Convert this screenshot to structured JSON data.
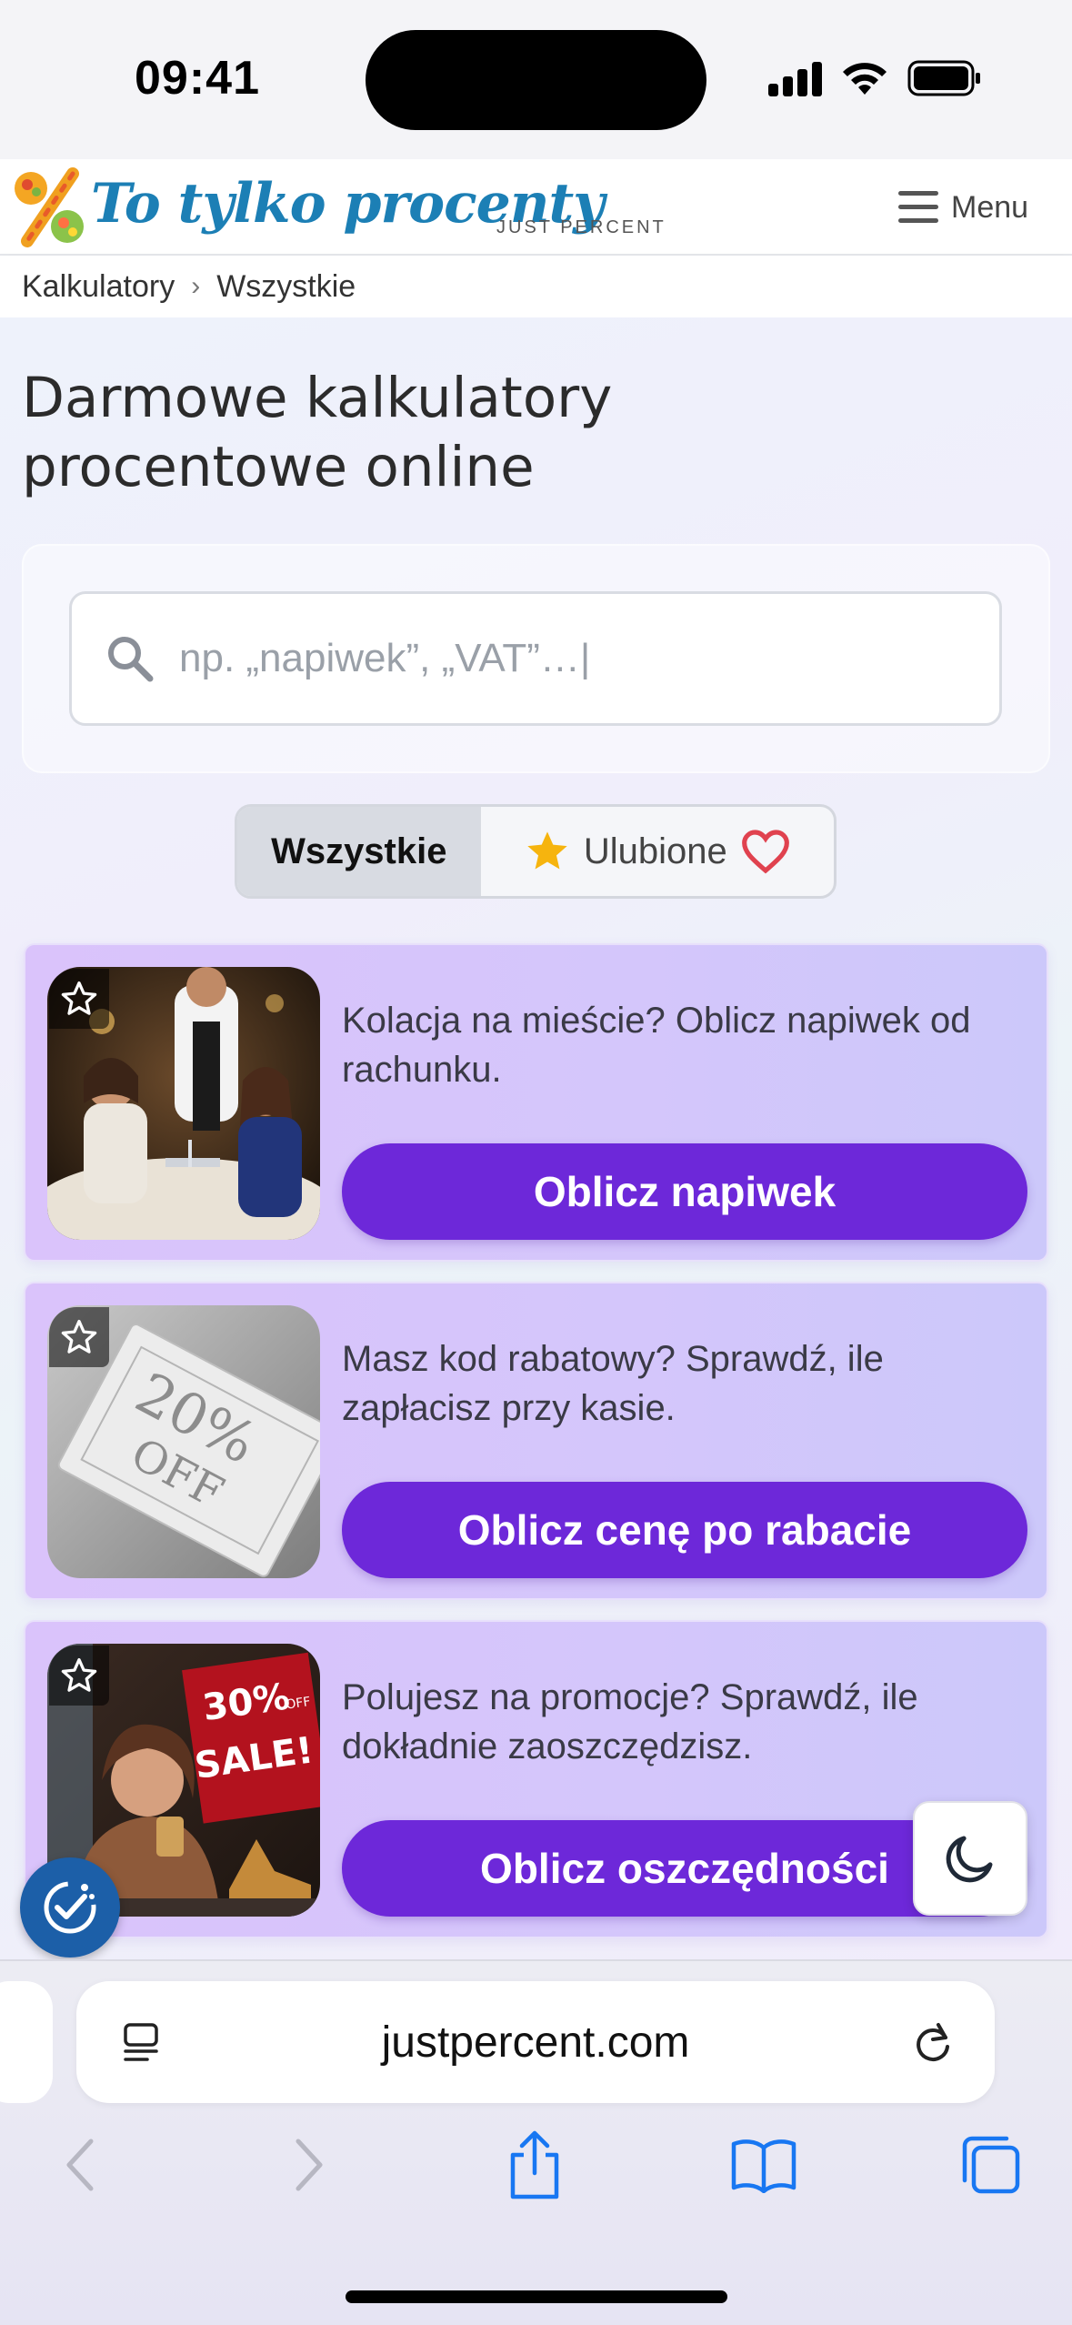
{
  "status_bar": {
    "time": "09:41"
  },
  "header": {
    "logo_text": "To tylko procenty",
    "logo_subtitle": "JUST PERCENT",
    "menu_label": "Menu"
  },
  "breadcrumb": {
    "items": [
      "Kalkulatory",
      "Wszystkie"
    ],
    "separator": "›"
  },
  "page": {
    "title": "Darmowe kalkulatory procentowe online"
  },
  "search": {
    "placeholder": "np. „napiwek”, „VAT”…|"
  },
  "tabs": [
    {
      "label": "Wszystkie",
      "active": true
    },
    {
      "label": "Ulubione",
      "active": false
    }
  ],
  "cards": [
    {
      "text": "Kolacja na mieście? Oblicz napiwek od rachunku.",
      "button": "Oblicz napiwek",
      "image": "restaurant-waiter-photo"
    },
    {
      "text": "Masz kod rabatowy? Sprawdź, ile zapłacisz przy kasie.",
      "button": "Oblicz cenę po rabacie",
      "image": "20-off-coupon-photo"
    },
    {
      "text": "Polujesz na promocje? Sprawdź, ile dokładnie zaoszczędzisz.",
      "button": "Oblicz oszczędności",
      "image": "sale-shopping-photo"
    }
  ],
  "coupon_text": {
    "line1": "20%",
    "line2": "OFF"
  },
  "sale_text": {
    "line1": "30%",
    "line2": "OFF",
    "line3": "SALE!"
  },
  "browser": {
    "url": "justpercent.com"
  },
  "colors": {
    "accent": "#6d28d9",
    "brand": "#1c7fb5",
    "a11y": "#1c5fa8",
    "safari_blue": "#1877f2"
  }
}
